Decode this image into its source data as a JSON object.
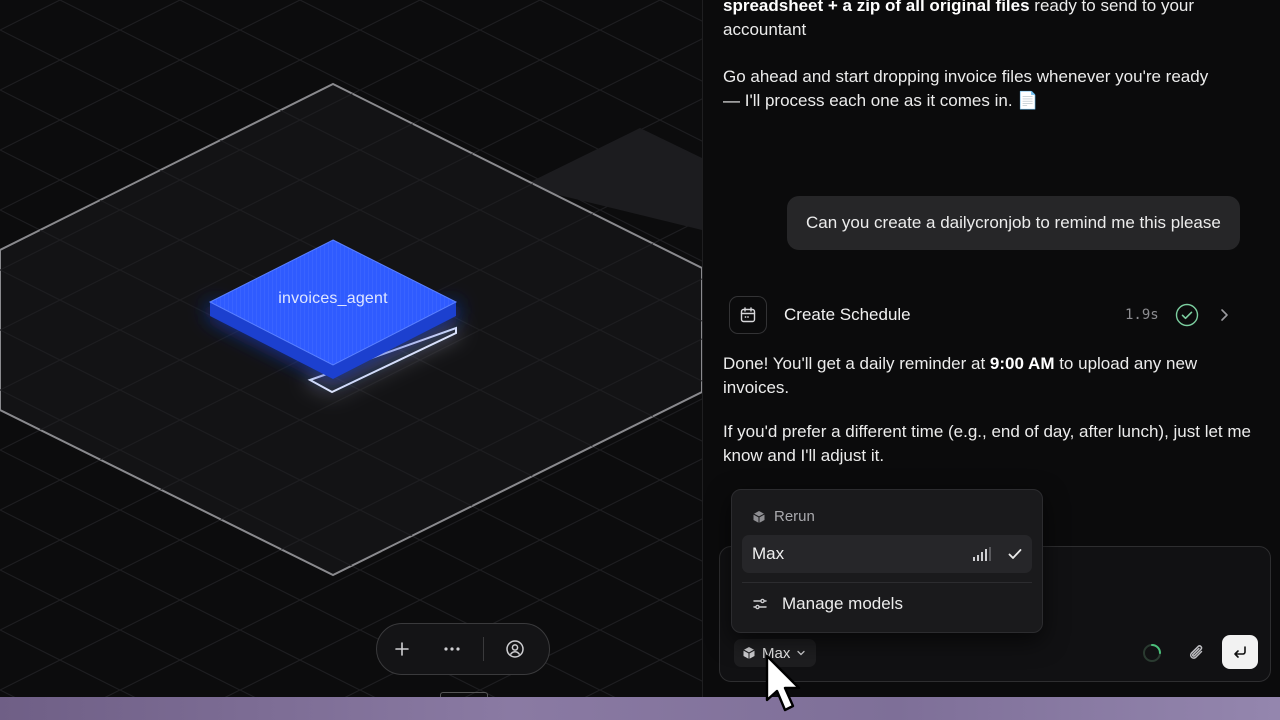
{
  "canvas": {
    "node_label": "invoices_agent",
    "node_color": "#2f5bff"
  },
  "chat": {
    "msg_top_bold": "spreadsheet + a zip of all original files",
    "msg_top_rest": " ready to send to your",
    "msg_top_line2": "accountant",
    "msg_go_ahead": "Go ahead and start dropping invoice files whenever you're ready — I'll process each one as it comes in. 📄",
    "user_message": "Can you create a dailycronjob to remind me this please",
    "tool": {
      "name": "Create Schedule",
      "duration": "1.9s",
      "icon": "calendar-icon"
    },
    "done_prefix": "Done! You'll get a daily reminder at ",
    "done_time": "9:00 AM",
    "done_suffix": " to upload any new invoices.",
    "followup": "If you'd prefer a different time (e.g., end of day, after lunch), just let me know and I'll adjust it."
  },
  "model_menu": {
    "header": "Rerun",
    "selected_model": "Max",
    "manage_label": "Manage models"
  },
  "composer": {
    "model_chip_label": "Max"
  },
  "colors": {
    "accent_blue": "#2f5bff",
    "bottom_bar": "#8a7aa3"
  }
}
